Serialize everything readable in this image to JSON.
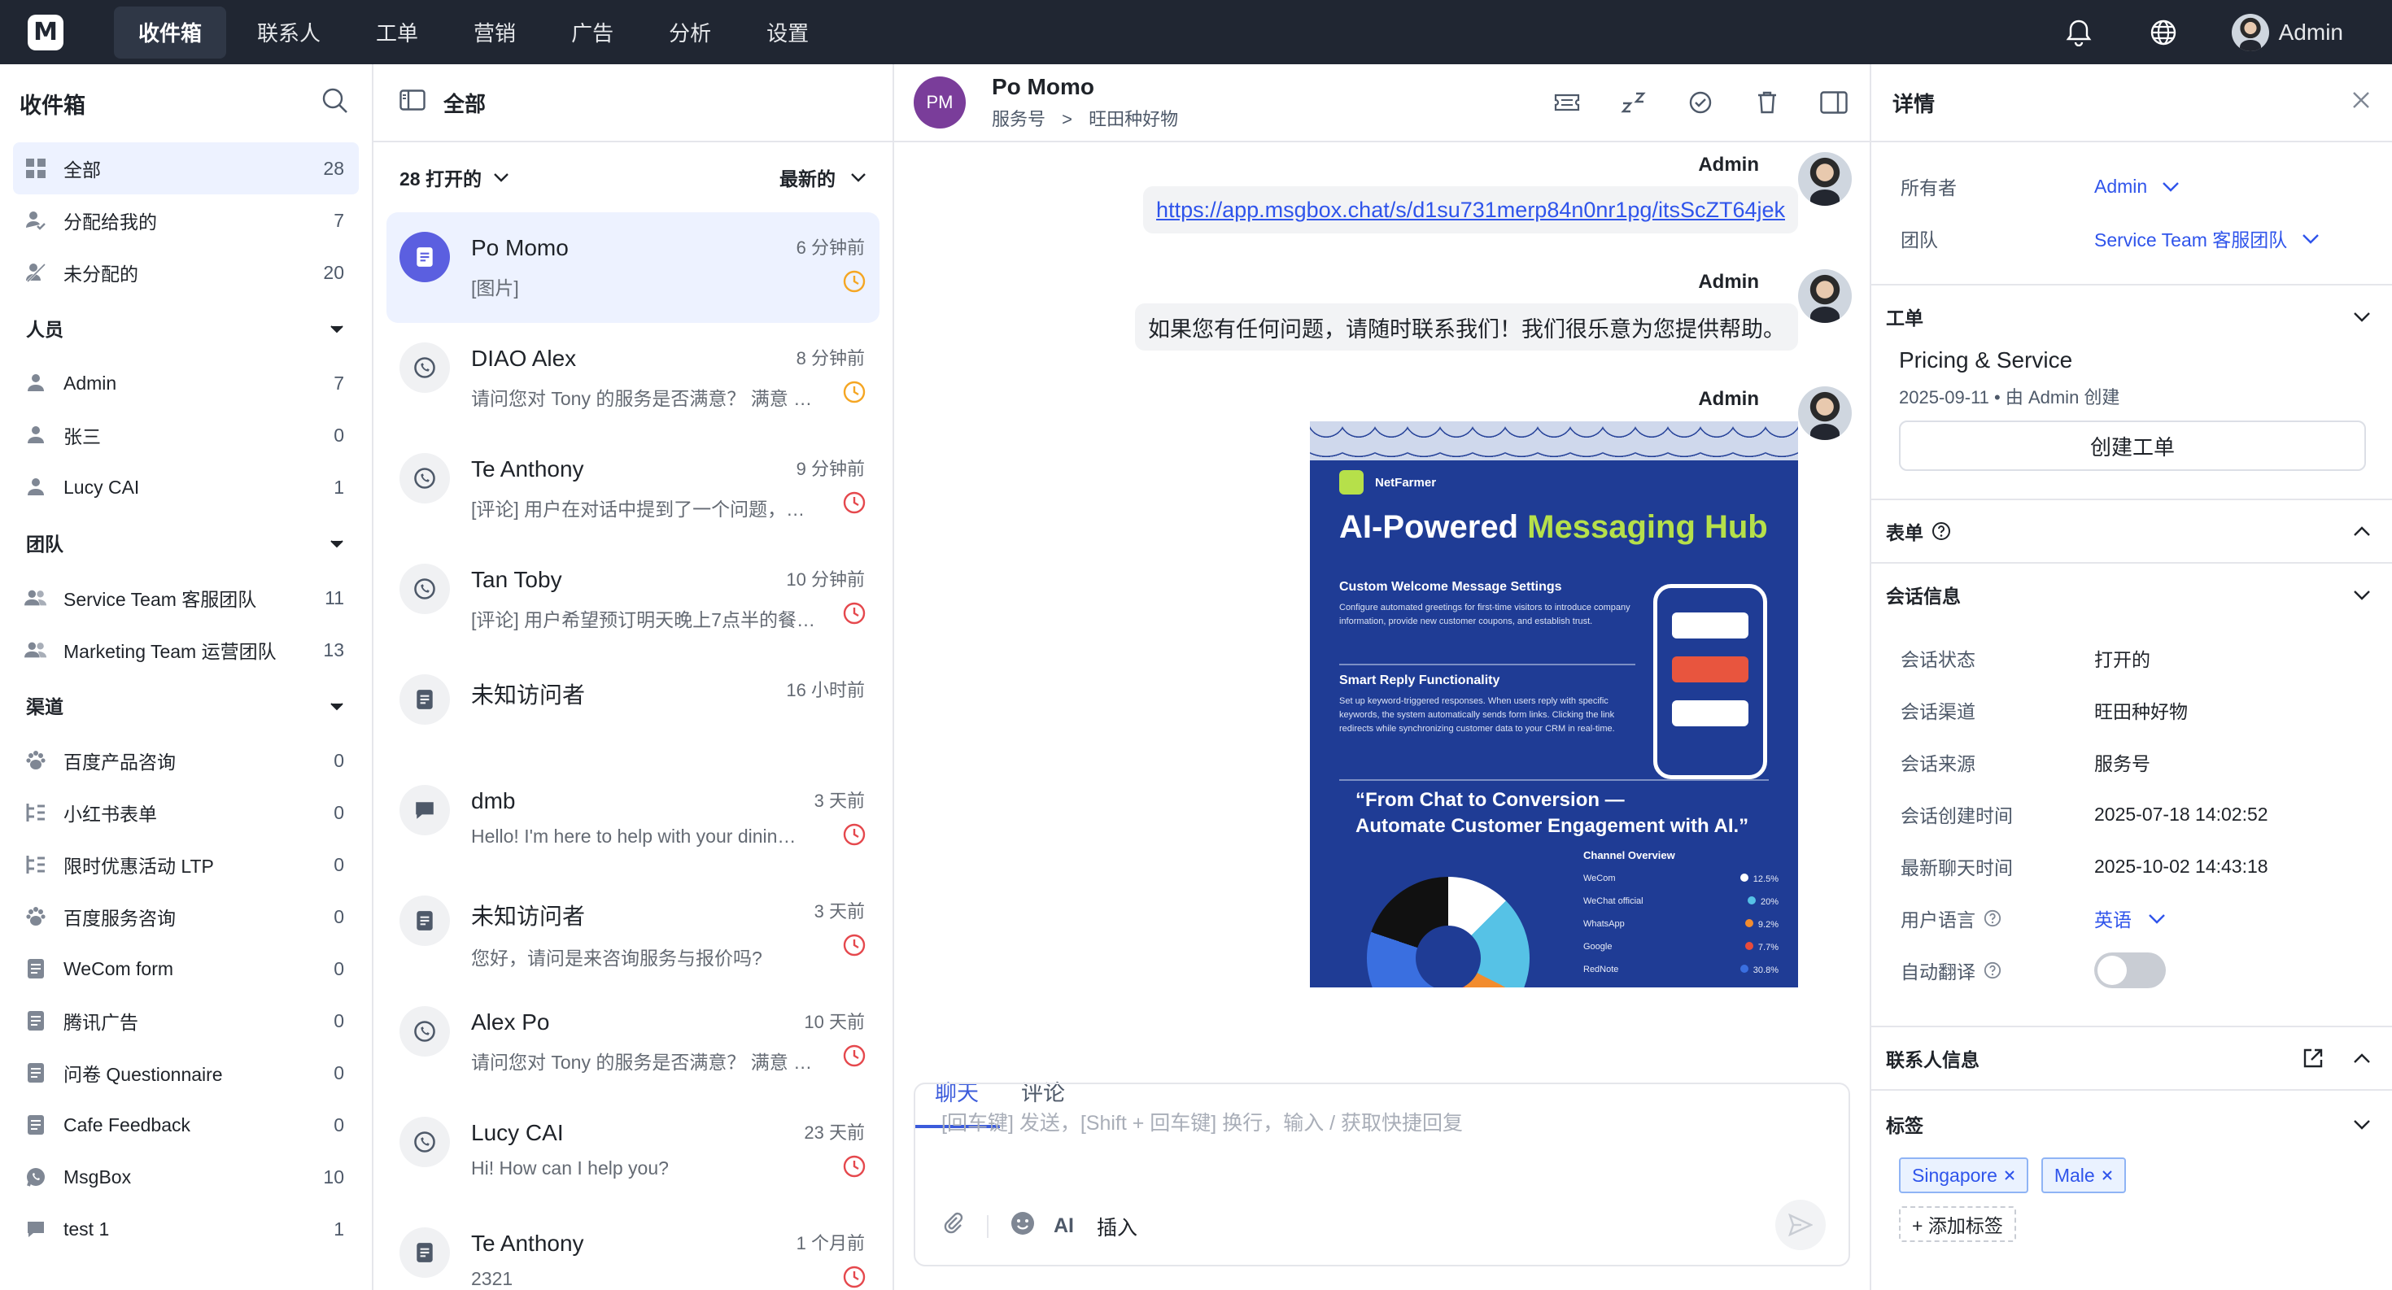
{
  "nav": {
    "logo": "M",
    "items": [
      "收件箱",
      "联系人",
      "工单",
      "营销",
      "广告",
      "分析",
      "设置"
    ],
    "user": "Admin"
  },
  "sidebar": {
    "title": "收件箱",
    "main": [
      {
        "label": "全部",
        "count": "28"
      },
      {
        "label": "分配给我的",
        "count": "7"
      },
      {
        "label": "未分配的",
        "count": "20"
      }
    ],
    "people_title": "人员",
    "people": [
      {
        "label": "Admin",
        "count": "7"
      },
      {
        "label": "张三",
        "count": "0"
      },
      {
        "label": "Lucy CAI",
        "count": "1"
      }
    ],
    "teams_title": "团队",
    "teams": [
      {
        "label": "Service Team 客服团队",
        "count": "11"
      },
      {
        "label": "Marketing Team 运营团队",
        "count": "13"
      }
    ],
    "channels_title": "渠道",
    "channels": [
      {
        "label": "百度产品咨询",
        "count": "0"
      },
      {
        "label": "小红书表单",
        "count": "0"
      },
      {
        "label": "限时优惠活动 LTP",
        "count": "0"
      },
      {
        "label": "百度服务咨询",
        "count": "0"
      },
      {
        "label": "WeCom form",
        "count": "0"
      },
      {
        "label": "腾讯广告",
        "count": "0"
      },
      {
        "label": "问卷 Questionnaire",
        "count": "0"
      },
      {
        "label": "Cafe Feedback",
        "count": "0"
      },
      {
        "label": "MsgBox",
        "count": "10"
      },
      {
        "label": "test 1",
        "count": "1"
      }
    ]
  },
  "list": {
    "title": "全部",
    "filter": "28 打开的",
    "sort": "最新的",
    "conversations": [
      {
        "name": "Po Momo",
        "snippet": "[图片]",
        "time": "6 分钟前",
        "clock": "#f5a623"
      },
      {
        "name": "DIAO Alex",
        "snippet": "请问您对 Tony 的服务是否满意？ 满意 我…",
        "time": "8 分钟前",
        "clock": "#f5a623"
      },
      {
        "name": "Te Anthony",
        "snippet": "[评论] 用户在对话中提到了一个问题，…",
        "time": "9 分钟前",
        "clock": "#e5484d"
      },
      {
        "name": "Tan Toby",
        "snippet": "[评论] 用户希望预订明天晚上7点半的餐厅…",
        "time": "10 分钟前",
        "clock": "#e5484d"
      },
      {
        "name": "未知访问者",
        "snippet": "",
        "time": "16 小时前",
        "clock": ""
      },
      {
        "name": "dmb",
        "snippet": "Hello! I'm here to help with your dinin…",
        "time": "3 天前",
        "clock": "#e5484d"
      },
      {
        "name": "未知访问者",
        "snippet": "您好，请问是来咨询服务与报价吗?",
        "time": "3 天前",
        "clock": "#e5484d"
      },
      {
        "name": "Alex Po",
        "snippet": "请问您对 Tony 的服务是否满意？ 满意 我…",
        "time": "10 天前",
        "clock": "#e5484d"
      },
      {
        "name": "Lucy CAI",
        "snippet": "Hi! How can I help you?",
        "time": "23 天前",
        "clock": "#e5484d"
      },
      {
        "name": "Te Anthony",
        "snippet": "2321",
        "time": "1 个月前",
        "clock": "#e5484d"
      }
    ]
  },
  "chat": {
    "avatar": "PM",
    "title": "Po Momo",
    "sub_source": "服务号",
    "sub_sep": ">",
    "sub_channel": "旺田种好物",
    "messages": [
      {
        "author": "Admin",
        "link": "https://app.msgbox.chat/s/d1su731merp84n0nr1pg/itsScZT64jek"
      },
      {
        "author": "Admin",
        "text": "如果您有任何问题，请随时联系我们！我们很乐意为您提供帮助。"
      },
      {
        "author": "Admin"
      }
    ],
    "poster": {
      "brand": "NetFarmer",
      "headline_a": "AI-Powered ",
      "headline_b": "Messaging Hub",
      "block1_title": "Custom Welcome Message Settings",
      "block1_body": "Configure automated greetings for first-time visitors to introduce company information, provide new customer coupons, and establish trust.",
      "block2_title": "Smart Reply Functionality",
      "block2_body": "Set up keyword-triggered responses. When users reply with specific keywords, the system automatically sends form links. Clicking the link redirects while synchronizing customer data to your CRM in real-time.",
      "quote_1": "“From Chat to Conversion —",
      "quote_2": "Automate Customer Engagement with AI.”",
      "overview": "Channel Overview",
      "legend": [
        {
          "name": "WeCom",
          "value": "12.5%",
          "color": "#ffffff"
        },
        {
          "name": "WeChat official",
          "value": "20%",
          "color": "#56c2e6"
        },
        {
          "name": "WhatsApp",
          "value": "9.2%",
          "color": "#f28c2e"
        },
        {
          "name": "Google",
          "value": "7.7%",
          "color": "#e84b3c"
        },
        {
          "name": "RedNote",
          "value": "30.8%",
          "color": "#3a6fe0"
        }
      ]
    },
    "tabs": [
      "聊天",
      "评论"
    ],
    "placeholder": "[回车键] 发送，[Shift + 回车键] 换行，输入 / 获取快捷回复",
    "tool_ai": "AI",
    "tool_insert": "插入"
  },
  "details": {
    "title": "详情",
    "owner_label": "所有者",
    "owner": "Admin",
    "team_label": "团队",
    "team": "Service Team 客服团队",
    "ticket_title": "工单",
    "ticket_name": "Pricing & Service",
    "ticket_meta": "2025-09-11 • 由 Admin 创建",
    "create_ticket": "创建工单",
    "form_title": "表单",
    "session_title": "会话信息",
    "session": [
      {
        "k": "会话状态",
        "v": "打开的"
      },
      {
        "k": "会话渠道",
        "v": "旺田种好物"
      },
      {
        "k": "会话来源",
        "v": "服务号"
      },
      {
        "k": "会话创建时间",
        "v": "2025-07-18 14:02:52"
      },
      {
        "k": "最新聊天时间",
        "v": "2025-10-02 14:43:18"
      }
    ],
    "lang_label": "用户语言",
    "lang": "英语",
    "translate_label": "自动翻译",
    "contact_title": "联系人信息",
    "tags_title": "标签",
    "tags": [
      "Singapore",
      "Male"
    ],
    "add_tag": "+ 添加标签"
  },
  "colors": {
    "accent": "#2f54eb",
    "nav": "#202632",
    "active_bg": "#edf2ff"
  }
}
